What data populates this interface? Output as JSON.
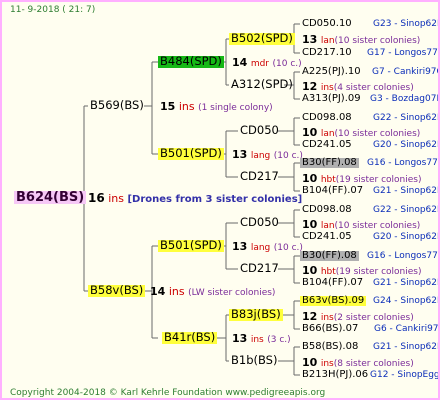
{
  "date": "11-  9-2018 (  21:  7)",
  "copyright": "Copyright 2004-2018 © Karl Kehrle Foundation    www.pedigreeapis.org",
  "root": {
    "label": "B624(BS)"
  },
  "root_info": {
    "num": "16",
    "sp": "ins",
    "text": "[Drones from 3 sister colonies]"
  },
  "a": {
    "label": "B569(BS)",
    "num": "15",
    "sp": "ins",
    "text": "(1 single colony)"
  },
  "b": {
    "label": "B58v(BS)",
    "num": "14",
    "sp": "ins",
    "text": "(LW sister colonies)"
  },
  "a1": {
    "label": "B484(SPD)",
    "num": "14",
    "sp": "mdr",
    "text": "(10 c.)"
  },
  "a2": {
    "label": "B501(SPD)",
    "num": "13",
    "sp": "lang",
    "text": "(10 c.)"
  },
  "b1": {
    "label": "B501(SPD)",
    "num": "13",
    "sp": "lang",
    "text": "(10 c.)"
  },
  "b2": {
    "label": "B41r(BS)",
    "num": "13",
    "sp": "ins",
    "text": "(3 c.)"
  },
  "a1a": {
    "label": "B502(SPD)",
    "num": "13",
    "sp": "lan",
    "text": "(10 sister colonies)"
  },
  "a1b": {
    "label": "A312(SPD)",
    "num": "12",
    "sp": "ins",
    "text": "(4 sister colonies)"
  },
  "a2a": {
    "label": "CD050",
    "num": "10",
    "sp": "lan",
    "text": "(10 sister colonies)"
  },
  "a2b": {
    "label": "CD217",
    "num": "10",
    "sp": "hbt",
    "text": "(19 sister colonies)"
  },
  "b1a": {
    "label": "CD050",
    "num": "10",
    "sp": "lan",
    "text": "(10 sister colonies)"
  },
  "b1b": {
    "label": "CD217",
    "num": "10",
    "sp": "hbt",
    "text": "(19 sister colonies)"
  },
  "b2a": {
    "label": "B83j(BS)",
    "num": "12",
    "sp": "ins",
    "text": "(2 sister colonies)"
  },
  "b2b": {
    "label": "B1b(BS)",
    "num": "10",
    "sp": "ins",
    "text": "(8 sister colonies)"
  },
  "leaves": [
    {
      "name": "CD050.10",
      "loc": "G23 - Sinop62R"
    },
    {
      "name": "CD217.10",
      "loc": "G17 - Longos77R"
    },
    {
      "name": "A225(PJ).10",
      "loc": "G7 - Cankiri97Q"
    },
    {
      "name": "A313(PJ).09",
      "loc": "G3 - Bozdag07R"
    },
    {
      "name": "CD098.08",
      "loc": "G22 - Sinop62R"
    },
    {
      "name": "CD241.05",
      "loc": "G20 - Sinop62R"
    },
    {
      "name": "B30(FF).08",
      "loc": "G16 - Longos77R"
    },
    {
      "name": "B104(FF).07",
      "loc": "G21 - Sinop62R"
    },
    {
      "name": "CD098.08",
      "loc": "G22 - Sinop62R"
    },
    {
      "name": "CD241.05",
      "loc": "G20 - Sinop62R"
    },
    {
      "name": "B30(FF).08",
      "loc": "G16 - Longos77R"
    },
    {
      "name": "B104(FF).07",
      "loc": "G21 - Sinop62R"
    },
    {
      "name": "B63v(BS).09",
      "loc": "G24 - Sinop62R"
    },
    {
      "name": "B66(BS).07",
      "loc": "G6 - Cankiri97Q"
    },
    {
      "name": "B58(BS).08",
      "loc": "G21 - Sinop62R"
    },
    {
      "name": "B213H(PJ).06",
      "loc": "G12 - SinopEgg86R"
    }
  ]
}
